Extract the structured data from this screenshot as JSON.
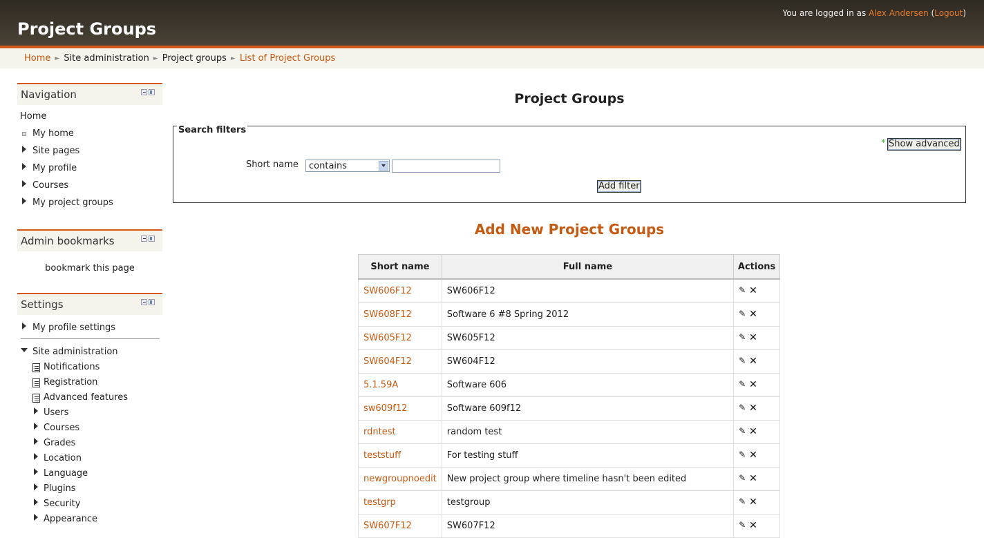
{
  "header": {
    "title": "Project Groups",
    "login_prefix": "You are logged in as",
    "user_name": "Alex Andersen",
    "logout": "Logout"
  },
  "breadcrumb": [
    "Home",
    "Site administration",
    "Project groups",
    "List of Project Groups"
  ],
  "navigation": {
    "title": "Navigation",
    "home": "Home",
    "my_home": "My home",
    "items": [
      "Site pages",
      "My profile",
      "Courses",
      "My project groups"
    ]
  },
  "admin_bookmarks": {
    "title": "Admin bookmarks",
    "link": "bookmark this page"
  },
  "settings": {
    "title": "Settings",
    "my_profile_settings": "My profile settings",
    "site_admin": "Site administration",
    "docs": [
      "Notifications",
      "Registration",
      "Advanced features"
    ],
    "folders": [
      "Users",
      "Courses",
      "Grades",
      "Location",
      "Language",
      "Plugins",
      "Security",
      "Appearance"
    ]
  },
  "main": {
    "title": "Project Groups",
    "filters": {
      "legend": "Search filters",
      "show_advanced": "Show advanced",
      "field_label": "Short name",
      "operator": "contains",
      "value": "",
      "add_filter": "Add filter"
    },
    "add_new": "Add New Project Groups",
    "table": {
      "headers": [
        "Short name",
        "Full name",
        "Actions"
      ],
      "rows": [
        {
          "short": "SW606F12",
          "full": "SW606F12"
        },
        {
          "short": "SW608F12",
          "full": "Software 6 #8 Spring 2012"
        },
        {
          "short": "SW605F12",
          "full": "SW605F12"
        },
        {
          "short": "SW604F12",
          "full": "SW604F12"
        },
        {
          "short": "5.1.59A",
          "full": "Software 606"
        },
        {
          "short": "sw609f12",
          "full": "Software 609f12"
        },
        {
          "short": "rdntest",
          "full": "random test"
        },
        {
          "short": "teststuff",
          "full": "For testing stuff"
        },
        {
          "short": "newgroupnoedit",
          "full": "New project group where timeline hasn't been edited"
        },
        {
          "short": "testgrp",
          "full": "testgroup"
        },
        {
          "short": "SW607F12",
          "full": "SW607F12"
        }
      ]
    }
  },
  "colors": {
    "accent": "#d5581a",
    "link": "#c55a11",
    "header_bg": "#3a342b"
  }
}
